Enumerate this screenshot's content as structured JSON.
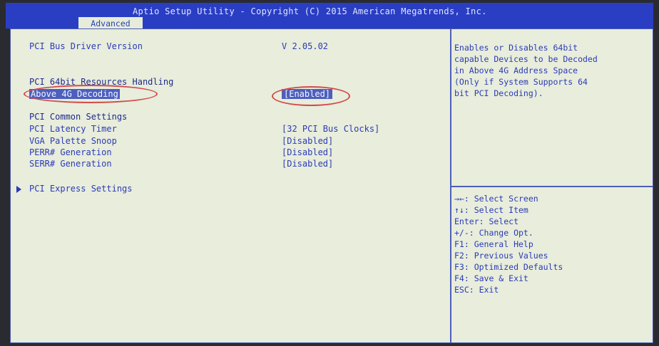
{
  "window": {
    "title": "Aptio Setup Utility - Copyright (C) 2015 American Megatrends, Inc.",
    "active_tab": "Advanced"
  },
  "settings": {
    "pci_bus_driver_version": {
      "label": "PCI Bus Driver Version",
      "value": "V 2.05.02"
    },
    "pci_64bit_heading": "PCI 64bit Resources Handling",
    "above_4g": {
      "label": "Above 4G Decoding",
      "value": "[Enabled]"
    },
    "pci_common_heading": "PCI Common Settings",
    "items": [
      {
        "label": "PCI Latency Timer",
        "value": "[32 PCI Bus Clocks]"
      },
      {
        "label": "VGA Palette Snoop",
        "value": "[Disabled]"
      },
      {
        "label": "PERR# Generation",
        "value": "[Disabled]"
      },
      {
        "label": "SERR# Generation",
        "value": "[Disabled]"
      }
    ],
    "submenu": "PCI Express Settings"
  },
  "help": {
    "lines": [
      "Enables or Disables 64bit",
      "capable Devices to be Decoded",
      "in Above 4G Address Space",
      "(Only if System Supports 64",
      "bit PCI Decoding)."
    ]
  },
  "keys": [
    "→←: Select Screen",
    "↑↓: Select Item",
    "Enter: Select",
    "+/-: Change Opt.",
    "F1: General Help",
    "F2: Previous Values",
    "F3: Optimized Defaults",
    "F4: Save & Exit",
    "ESC: Exit"
  ],
  "colors": {
    "title_bar": "#2a3ec4",
    "panel_background": "#e8eddc",
    "text_blue": "#2b3bb6",
    "highlight_ellipse": "#d44a4a"
  }
}
